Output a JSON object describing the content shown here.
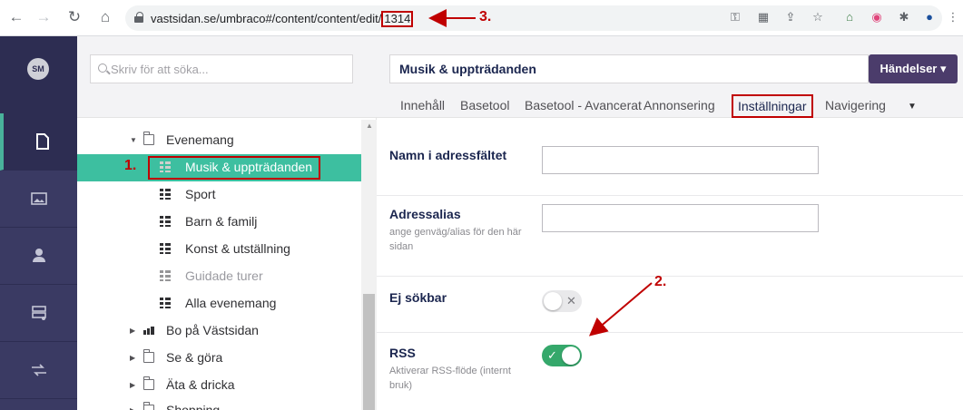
{
  "browser": {
    "url_prefix": "vastsidan.se/umbraco#/content/content/edit/",
    "url_id": "1314",
    "annotation": "3."
  },
  "rail": {
    "avatar": "SM",
    "items": [
      "content-icon",
      "media-icon",
      "members-icon",
      "settings-icon",
      "translation-icon"
    ],
    "accent": "#49b29b"
  },
  "tree": {
    "search_placeholder": "Skriv för att söka...",
    "selected_annotation": "1.",
    "items": [
      {
        "label": "Evenemang",
        "icon": "folder-icon",
        "expanded": true
      },
      {
        "label": "Musik & uppträdanden",
        "icon": "doclist-icon",
        "selected": true
      },
      {
        "label": "Sport",
        "icon": "doclist-icon"
      },
      {
        "label": "Barn & familj",
        "icon": "doclist-icon"
      },
      {
        "label": "Konst & utställning",
        "icon": "doclist-icon"
      },
      {
        "label": "Guidade turer",
        "icon": "doclist-icon",
        "unpublished": true
      },
      {
        "label": "Alla evenemang",
        "icon": "doclist-icon"
      },
      {
        "label": "Bo på Västsidan",
        "icon": "home-icon"
      },
      {
        "label": "Se & göra",
        "icon": "folder-icon"
      },
      {
        "label": "Äta & dricka",
        "icon": "folder-icon"
      },
      {
        "label": "Shopping",
        "icon": "folder-icon"
      }
    ]
  },
  "editor": {
    "node_name": "Musik & uppträdanden",
    "actions_label": "Händelser ▾",
    "tabs": [
      "Innehåll",
      "Basetool",
      "Basetool - Avancerat",
      "Annonsering",
      "Inställningar",
      "Navigering"
    ],
    "active_tab": "Inställningar",
    "properties": {
      "url_name": {
        "label": "Namn i adressfältet",
        "value": ""
      },
      "url_alias": {
        "label": "Adressalias",
        "description": "ange genväg/alias för den här sidan",
        "value": ""
      },
      "hide_search": {
        "label": "Ej sökbar",
        "checked": false
      },
      "rss": {
        "label": "RSS",
        "description": "Aktiverar RSS-flöde (internt bruk)",
        "checked": true
      }
    },
    "toggle_annotation": "2."
  },
  "colors": {
    "annotation": "#c00000",
    "selected_tree": "#3dbfa0",
    "toggle_on": "#35a86b",
    "actions": "#4b3c6b"
  }
}
